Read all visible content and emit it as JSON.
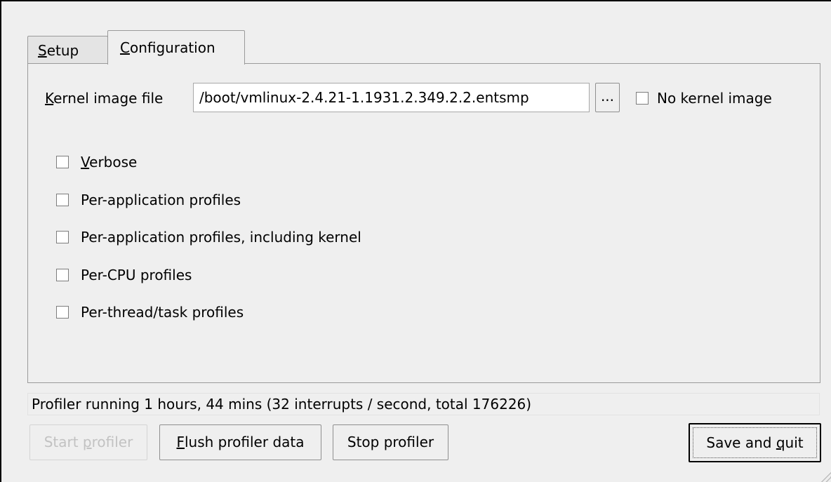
{
  "tabs": {
    "setup": {
      "label": "Setup",
      "mnemonic": "S",
      "rest": "etup",
      "selected": false
    },
    "configuration": {
      "label": "Configuration",
      "mnemonic": "C",
      "rest": "onfiguration",
      "selected": true
    }
  },
  "kernel": {
    "label": "Kernel image file",
    "label_mnemonic": "K",
    "label_rest": "ernel image file",
    "value": "/boot/vmlinux-2.4.21-1.1931.2.349.2.2.entsmp",
    "browse_label": "...",
    "no_kernel_label": "No kernel image",
    "no_kernel_checked": false
  },
  "options": {
    "verbose": {
      "label": "Verbose",
      "mnemonic": "V",
      "rest": "erbose",
      "checked": false
    },
    "per_application": {
      "label": "Per-application profiles",
      "checked": false
    },
    "per_application_kernel": {
      "label": "Per-application profiles, including kernel",
      "checked": false
    },
    "per_cpu": {
      "label": "Per-CPU profiles",
      "checked": false
    },
    "per_thread": {
      "label": "Per-thread/task profiles",
      "checked": false
    }
  },
  "status": {
    "text": "Profiler running 1 hours, 44 mins (32 interrupts / second, total 176226)"
  },
  "buttons": {
    "start": {
      "label": "Start profiler",
      "pre": "Start ",
      "mnemonic": "p",
      "post": "rofiler",
      "enabled": false
    },
    "flush": {
      "label": "Flush profiler data",
      "pre": "",
      "mnemonic": "F",
      "post": "lush profiler data",
      "enabled": true
    },
    "stop": {
      "label": "Stop profiler",
      "enabled": true
    },
    "save_quit": {
      "label": "Save and quit",
      "pre": "Save and ",
      "mnemonic": "q",
      "post": "uit",
      "enabled": true,
      "focused": true
    }
  },
  "colors": {
    "window_bg": "#efefef",
    "border": "#000000",
    "disabled_text": "#c2c2c2"
  }
}
